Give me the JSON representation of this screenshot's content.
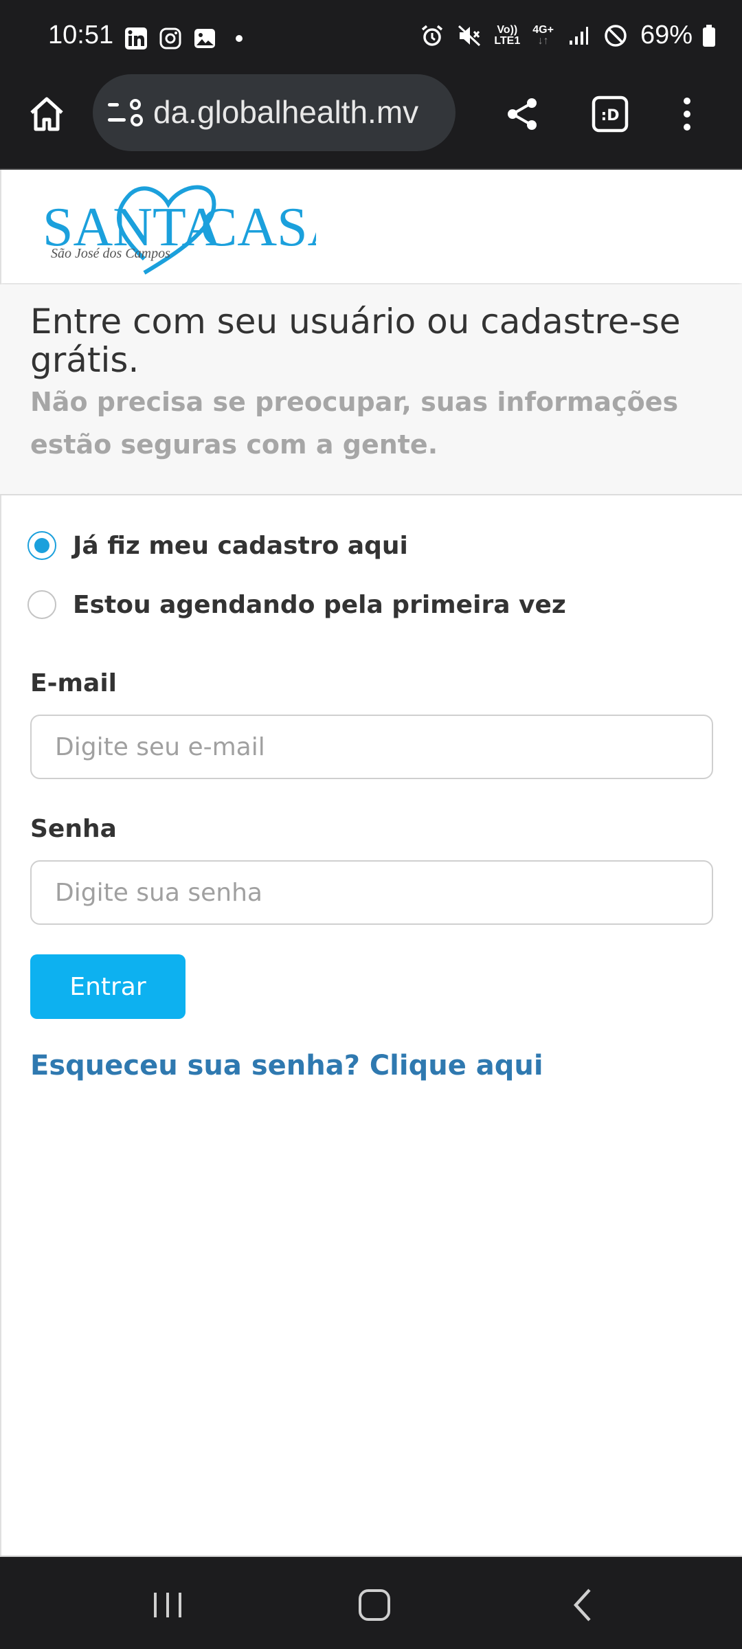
{
  "status_bar": {
    "time": "10:51",
    "left_icons": [
      "linkedin-icon",
      "instagram-icon",
      "gallery-icon",
      "dot-icon"
    ],
    "right_icons": [
      "alarm-icon",
      "mute-icon",
      "volte-icon",
      "4g-icon",
      "signal-icon",
      "dnd-icon",
      "battery-icon"
    ],
    "volte_text_top": "Vo))",
    "volte_text_bottom": "LTE1",
    "network_text": "4G+",
    "battery": "69%"
  },
  "browser": {
    "url": "da.globalhealth.mv",
    "icons": [
      "home-icon",
      "site-settings-icon",
      "share-icon",
      "tab-switcher-icon",
      "more-icon"
    ],
    "tab_label": ":D"
  },
  "logo": {
    "line1a": "SANTA",
    "line1b": "CASA",
    "line2": "São José dos Campos",
    "brand_color": "#1ba0dc"
  },
  "intro": {
    "title": "Entre com seu usuário ou cadastre-se grátis.",
    "subtitle": "Não precisa se preocupar, suas informações estão seguras com a gente."
  },
  "form": {
    "radio_options": [
      {
        "label": "Já fiz meu cadastro aqui",
        "checked": true
      },
      {
        "label": "Estou agendando pela primeira vez",
        "checked": false
      }
    ],
    "email_label": "E-mail",
    "email_placeholder": "Digite seu e-mail",
    "email_value": "",
    "password_label": "Senha",
    "password_placeholder": "Digite sua senha",
    "password_value": "",
    "submit_label": "Entrar",
    "forgot_link": "Esqueceu sua senha? Clique aqui"
  },
  "nav_bar": {
    "icons": [
      "recents-icon",
      "home-nav-icon",
      "back-icon"
    ]
  },
  "colors": {
    "accent": "#0db1f0",
    "link": "#2f79b0",
    "system_bar": "#1c1c1e"
  }
}
